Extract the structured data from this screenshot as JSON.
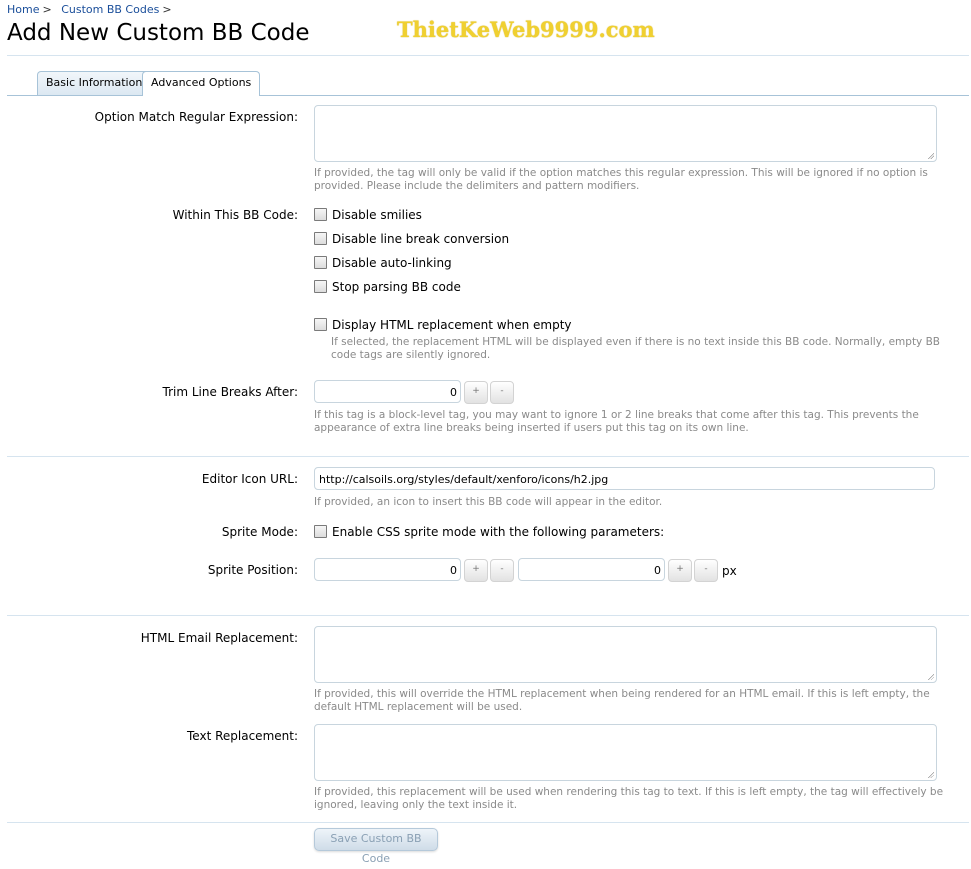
{
  "breadcrumb": {
    "home": "Home",
    "custom_bb_codes": "Custom BB Codes",
    "separator": ">"
  },
  "page_title": "Add New Custom BB Code",
  "watermark": "ThietKeWeb9999.com",
  "tabs": [
    {
      "label": "Basic Information",
      "active": false
    },
    {
      "label": "Advanced Options",
      "active": true
    }
  ],
  "option_regex": {
    "label": "Option Match Regular Expression:",
    "value": "",
    "hint": "If provided, the tag will only be valid if the option matches this regular expression. This will be ignored if no option is provided. Please include the delimiters and pattern modifiers."
  },
  "within_bb_code": {
    "label": "Within This BB Code:",
    "options": [
      {
        "label": "Disable smilies",
        "checked": false
      },
      {
        "label": "Disable line break conversion",
        "checked": false
      },
      {
        "label": "Disable auto-linking",
        "checked": false
      },
      {
        "label": "Stop parsing BB code",
        "checked": false
      }
    ]
  },
  "display_html_empty": {
    "label": "Display HTML replacement when empty",
    "checked": false,
    "hint": "If selected, the replacement HTML will be displayed even if there is no text inside this BB code. Normally, empty BB code tags are silently ignored."
  },
  "trim_line_breaks": {
    "label": "Trim Line Breaks After:",
    "value": "0",
    "plus": "+",
    "minus": "-",
    "hint": "If this tag is a block-level tag, you may want to ignore 1 or 2 line breaks that come after this tag. This prevents the appearance of extra line breaks being inserted if users put this tag on its own line."
  },
  "editor_icon": {
    "label": "Editor Icon URL:",
    "value": "http://calsoils.org/styles/default/xenforo/icons/h2.jpg",
    "hint": "If provided, an icon to insert this BB code will appear in the editor."
  },
  "sprite_mode": {
    "label": "Sprite Mode:",
    "option": "Enable CSS sprite mode with the following parameters:",
    "checked": false
  },
  "sprite_position": {
    "label": "Sprite Position:",
    "x": "0",
    "y": "0",
    "plus": "+",
    "minus": "-",
    "unit": "px"
  },
  "html_email": {
    "label": "HTML Email Replacement:",
    "value": "",
    "hint": "If provided, this will override the HTML replacement when being rendered for an HTML email. If this is left empty, the default HTML replacement will be used."
  },
  "text_replacement": {
    "label": "Text Replacement:",
    "value": "",
    "hint": "If provided, this replacement will be used when rendering this tag to text. If this is left empty, the tag will effectively be ignored, leaving only the text inside it."
  },
  "save_button": "Save Custom BB Code"
}
